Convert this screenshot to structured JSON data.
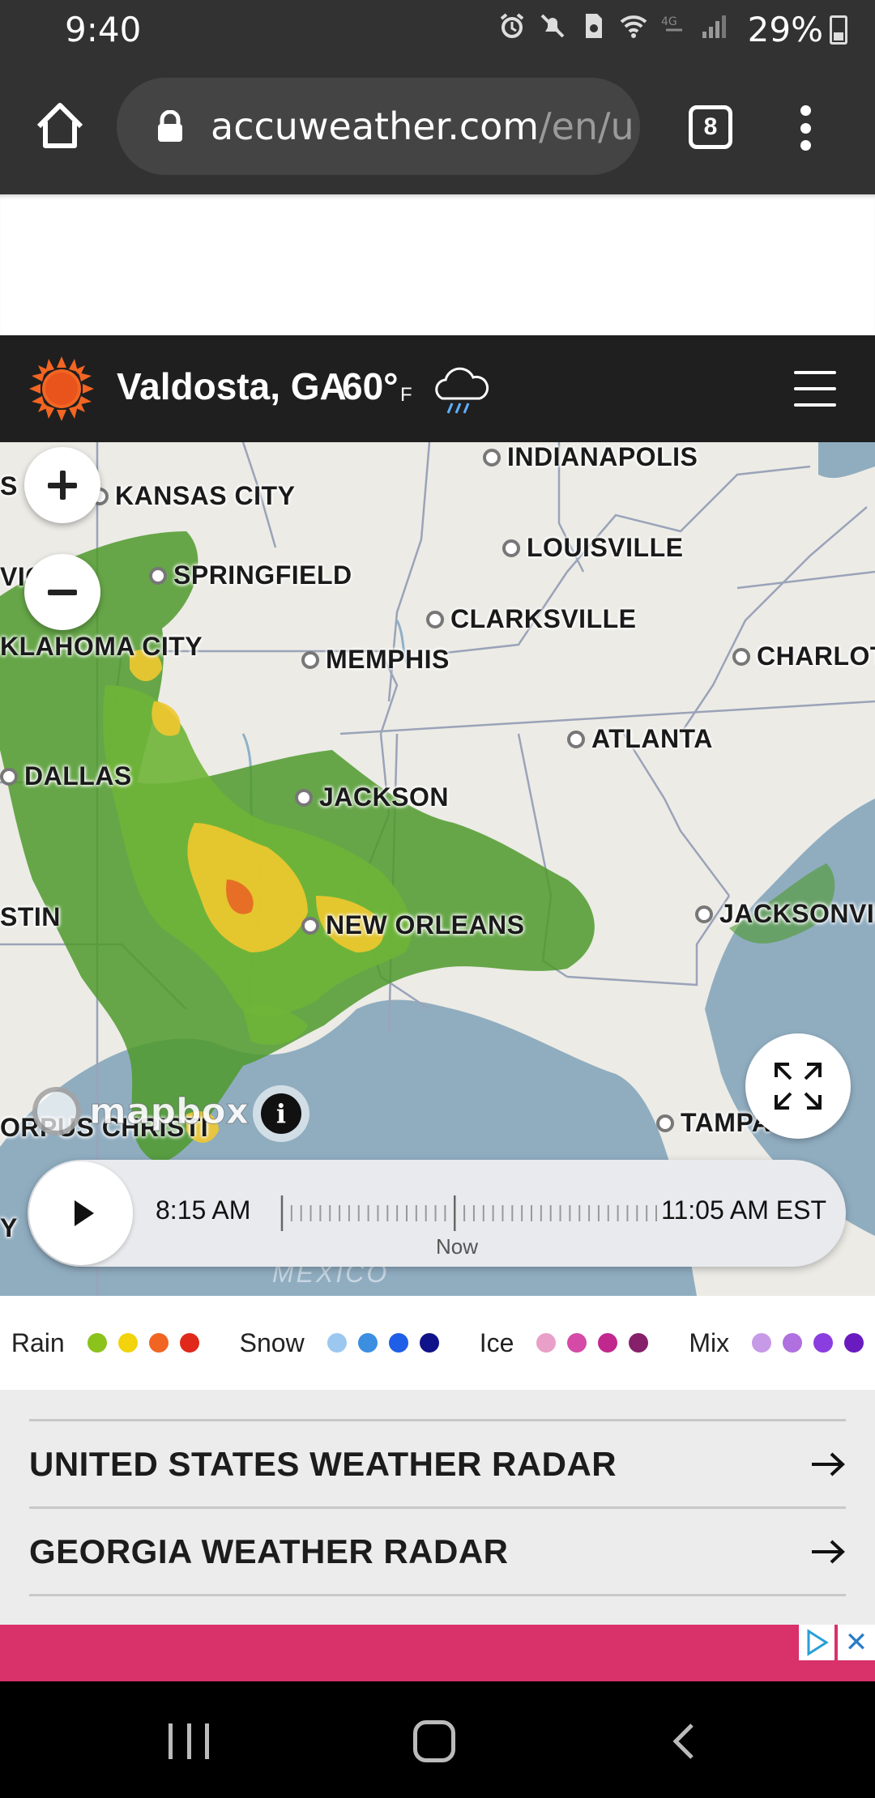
{
  "status_bar": {
    "time": "9:40",
    "battery": "29%",
    "icons": [
      "alarm-icon",
      "mute-icon",
      "sim-icon",
      "wifi-icon",
      "4g-icon",
      "signal-icon",
      "battery-icon"
    ]
  },
  "browser": {
    "url_main": "accuweather.com",
    "url_rest": "/en/u",
    "tab_count": "8",
    "icons": [
      "home-icon",
      "lock-icon",
      "tabs-icon",
      "more-icon"
    ]
  },
  "site_header": {
    "location": "Valdosta, GA",
    "temperature": "60°",
    "unit": "F",
    "icons": [
      "sun-logo-icon",
      "rain-cloud-icon",
      "hamburger-menu-icon"
    ]
  },
  "map": {
    "cities": [
      {
        "name": "INDIANAPOLIS"
      },
      {
        "name": "KANSAS CITY"
      },
      {
        "name": "LOUISVILLE"
      },
      {
        "name": "SPRINGFIELD"
      },
      {
        "name": "CLARKSVILLE"
      },
      {
        "name": "KLAHOMA CITY"
      },
      {
        "name": "MEMPHIS"
      },
      {
        "name": "CHARLOT"
      },
      {
        "name": "ATLANTA"
      },
      {
        "name": "DALLAS"
      },
      {
        "name": "JACKSON"
      },
      {
        "name": "STIN"
      },
      {
        "name": "JACKSONVIL"
      },
      {
        "name": "NEW ORLEANS"
      },
      {
        "name": "ORPUS CHRISTI"
      },
      {
        "name": "TAMPA"
      }
    ],
    "edge_fragments": [
      "S",
      "VIC",
      "Y"
    ],
    "attribution": "mapbox",
    "info_label": "i",
    "water_label": "MEXICO",
    "timeline": {
      "start": "8:15 AM",
      "end": "11:05 AM EST",
      "now_label": "Now",
      "now_fraction": 0.47
    }
  },
  "legend": [
    {
      "label": "Rain",
      "colors": [
        "#8bc21b",
        "#f2d30c",
        "#f06522",
        "#e0291b"
      ]
    },
    {
      "label": "Snow",
      "colors": [
        "#9cc8f0",
        "#3b8ee0",
        "#1f5ee6",
        "#10128a"
      ]
    },
    {
      "label": "Ice",
      "colors": [
        "#e8a0c8",
        "#d44aa6",
        "#c1288e",
        "#86206a"
      ]
    },
    {
      "label": "Mix",
      "colors": [
        "#c79ae8",
        "#b070e0",
        "#8a3ee0",
        "#6a1bc0"
      ]
    }
  ],
  "links": [
    {
      "label": "UNITED STATES WEATHER RADAR",
      "icon": "arrow-right-icon"
    },
    {
      "label": "GEORGIA WEATHER RADAR",
      "icon": "arrow-right-icon"
    }
  ],
  "ad": {
    "close_label": "✕"
  },
  "colors": {
    "status_bg": "#323232",
    "header_bg": "#1f1f1f",
    "sun": "#f26522",
    "ad": "#d9316a",
    "water": "#90adc0",
    "land": "#ecebe6",
    "radar_green": "#4f9a2b",
    "radar_yellow": "#f1c82f"
  }
}
